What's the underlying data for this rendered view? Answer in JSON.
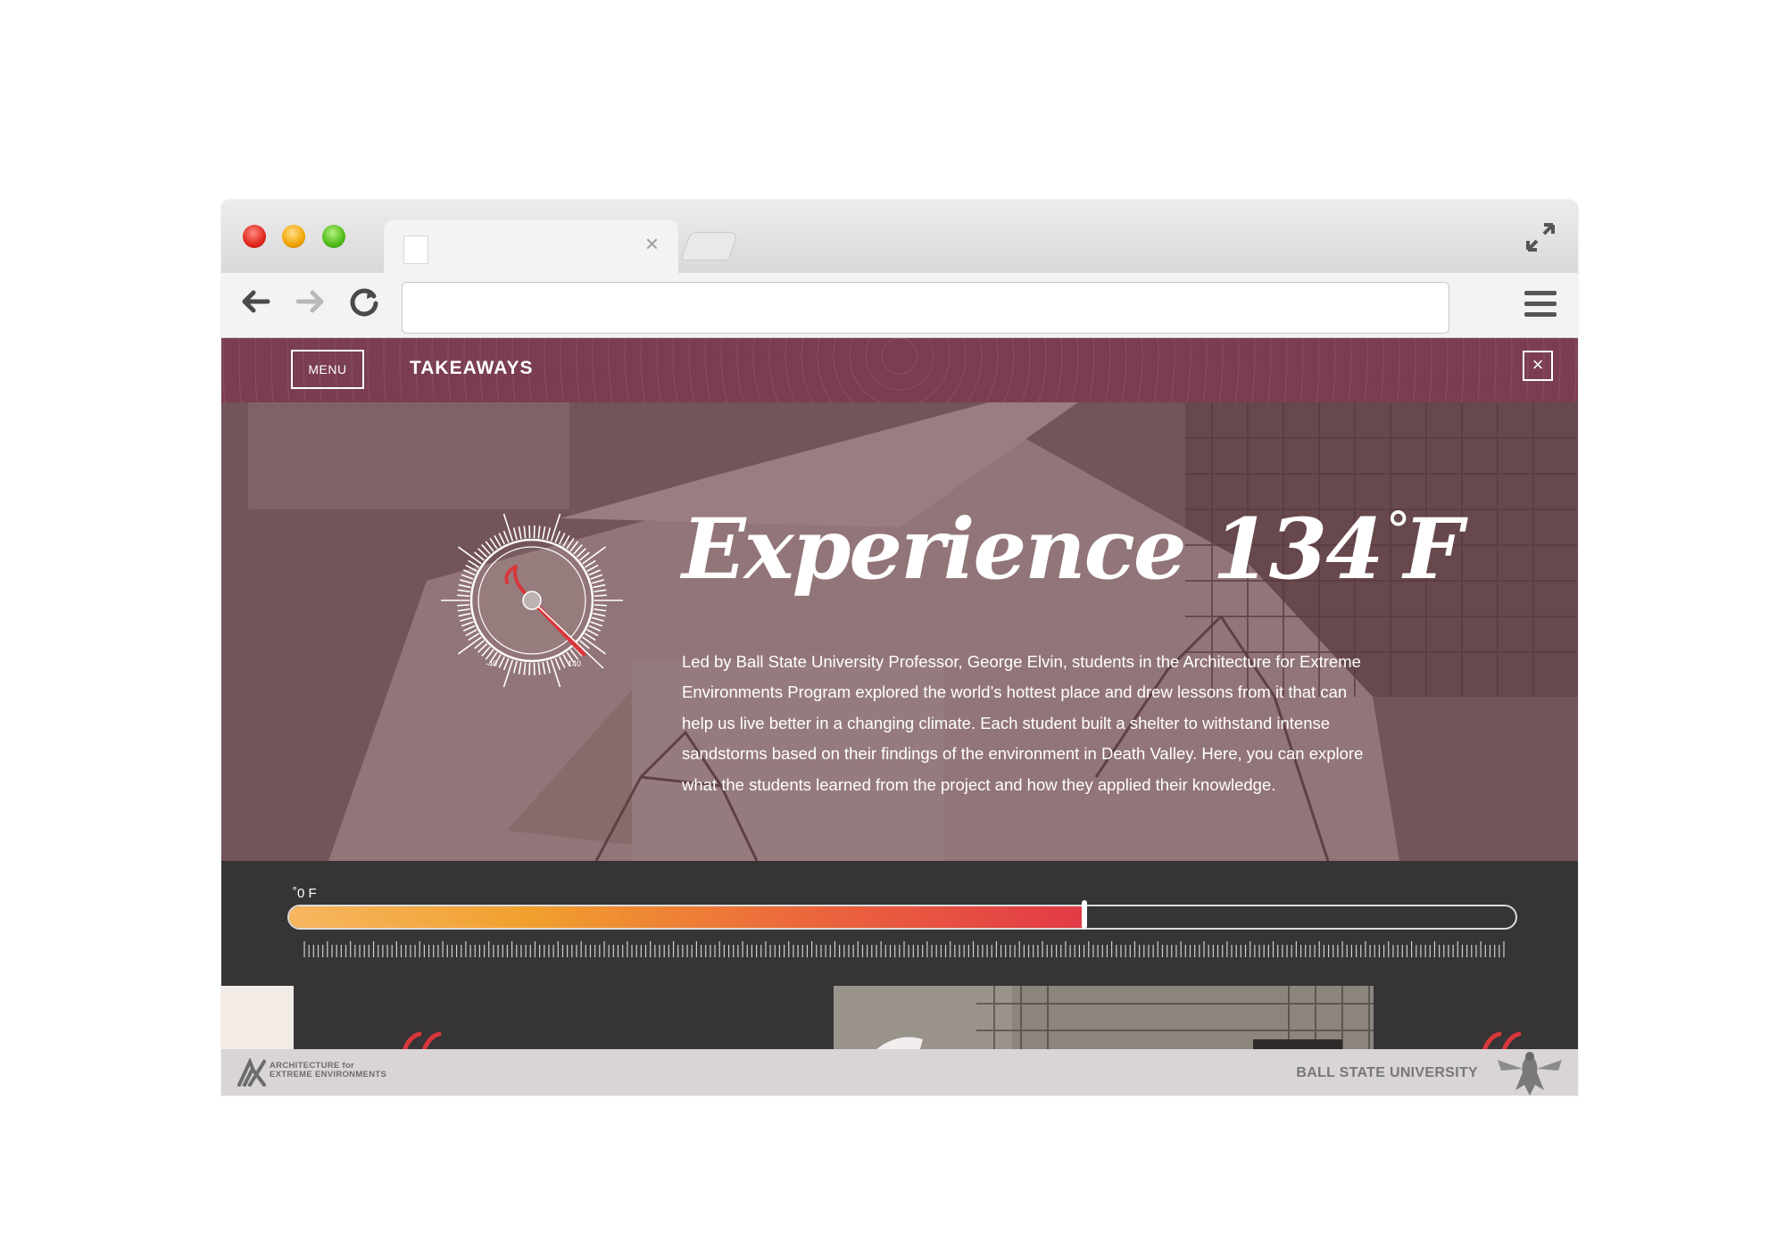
{
  "browser": {
    "tab": {
      "title": ""
    },
    "address_bar": {
      "value": ""
    }
  },
  "header": {
    "menu_label": "MENU",
    "section_title": "TAKEAWAYS",
    "close_symbol": "×"
  },
  "hero": {
    "headline_main": "Experience 134",
    "headline_degree": "°",
    "headline_unit": "F",
    "body": "Led by Ball State University Professor, George Elvin, students in the Architecture for Extreme Environments Program explored the world’s hottest place and drew lessons from it that can help us live better in a changing climate. Each student built a shelter to withstand intense sandstorms based on their findings of the environment in Death Valley. Here, you can explore what the students learned from the project and how they applied their knowledge.",
    "gauge": {
      "min_label": "-40",
      "max_label": "140"
    }
  },
  "temperature_slider": {
    "label": "˚0 F",
    "value_fraction": 0.65,
    "colors": {
      "start": "#f7b660",
      "end": "#e23a47"
    }
  },
  "footer": {
    "left_logo_line1": "ARCHITECTURE for",
    "left_logo_line2": "EXTREME ENVIRONMENTS",
    "right_text": "BALL STATE UNIVERSITY"
  },
  "theme": {
    "header_bg": "#7a3e50",
    "accent_red": "#d8383c",
    "panel_dark": "#363434"
  },
  "icons": [
    "back-arrow-icon",
    "forward-arrow-icon",
    "reload-icon",
    "hamburger-menu-icon",
    "fullscreen-icon",
    "close-icon",
    "thermometer-gauge-icon",
    "quote-icon",
    "aee-logo-icon",
    "bsu-cardinal-logo-icon"
  ]
}
